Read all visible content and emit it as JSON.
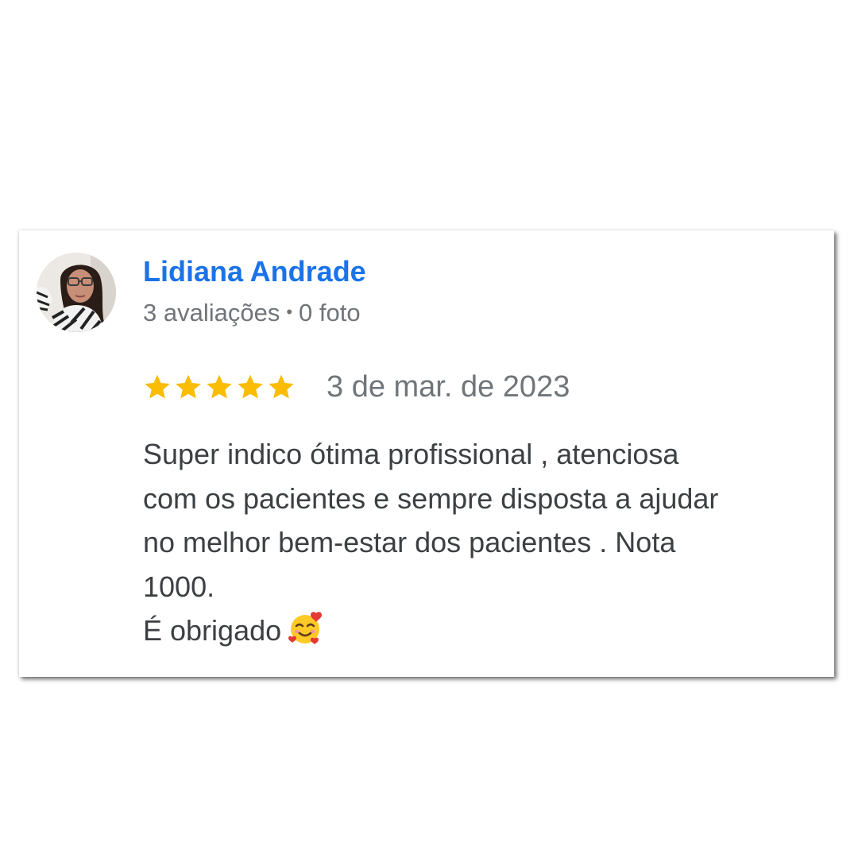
{
  "review": {
    "reviewer_name": "Lidiana Andrade",
    "reviews_count": "3 avaliações",
    "separator": "•",
    "photos_count": "0 foto",
    "rating": 5,
    "rating_max": 5,
    "date": "3 de mar. de 2023",
    "text": "Super indico ótima profissional , atenciosa\ncom os pacientes e sempre disposta a ajudar\nno melhor bem-estar dos pacientes . Nota\n1000.\nÉ obrigado",
    "emoji_icon": "smiling-face-with-hearts-icon"
  },
  "colors": {
    "name": "#1a73e8",
    "meta": "#70757a",
    "text": "#3c4043",
    "star": "#fbbc04"
  }
}
